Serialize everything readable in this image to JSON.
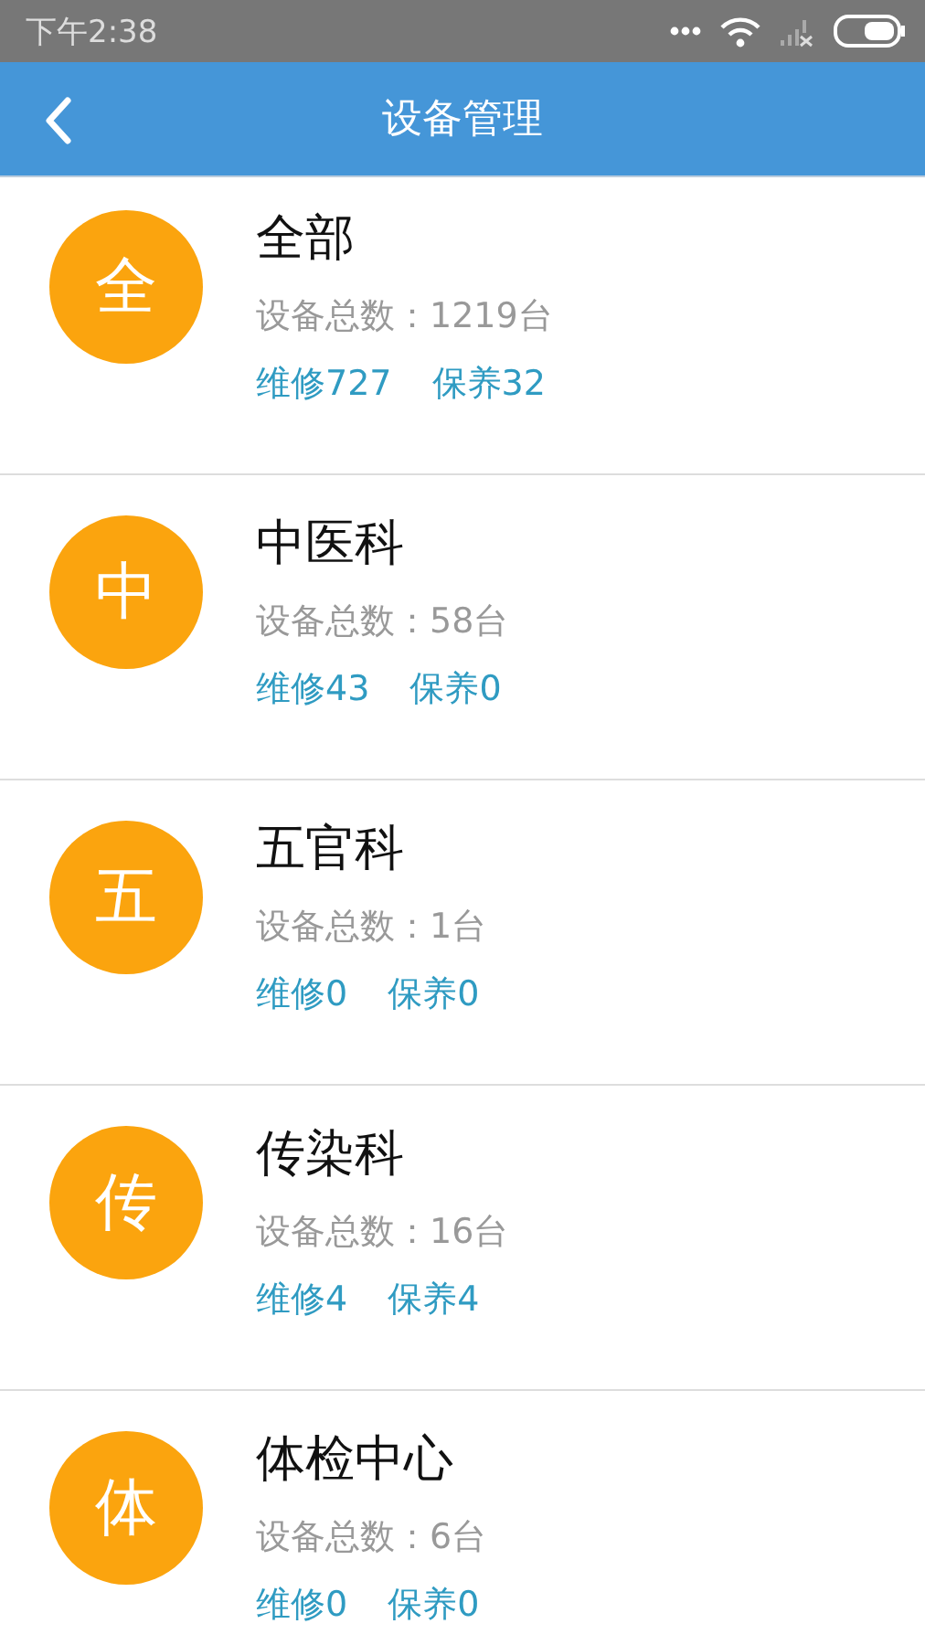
{
  "status_bar": {
    "time": "下午2:38"
  },
  "header": {
    "title": "设备管理"
  },
  "departments": [
    {
      "avatar": "全",
      "name": "全部",
      "total": "设备总数：1219台",
      "repair": "维修727",
      "maintain": "保养32"
    },
    {
      "avatar": "中",
      "name": "中医科",
      "total": "设备总数：58台",
      "repair": "维修43",
      "maintain": "保养0"
    },
    {
      "avatar": "五",
      "name": "五官科",
      "total": "设备总数：1台",
      "repair": "维修0",
      "maintain": "保养0"
    },
    {
      "avatar": "传",
      "name": "传染科",
      "total": "设备总数：16台",
      "repair": "维修4",
      "maintain": "保养4"
    },
    {
      "avatar": "体",
      "name": "体检中心",
      "total": "设备总数：6台",
      "repair": "维修0",
      "maintain": "保养0"
    }
  ]
}
